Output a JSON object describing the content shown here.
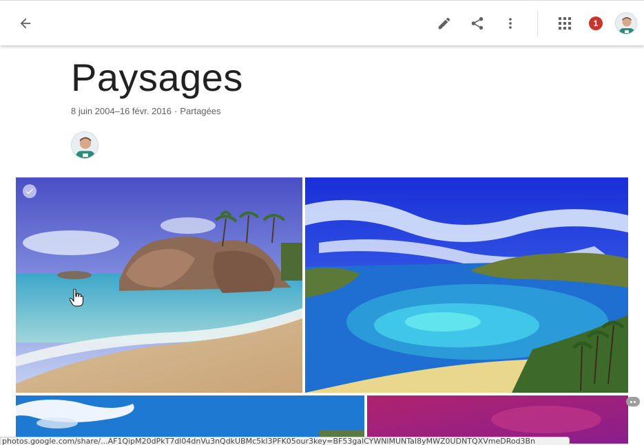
{
  "header": {
    "icons": {
      "back": "arrow-back-icon",
      "edit": "pencil-icon",
      "share": "share-icon",
      "more": "more-vert-icon",
      "apps": "apps-grid-icon"
    },
    "notification_count": "1"
  },
  "album": {
    "title": "Paysages",
    "date_range": "8 juin 2004–16 févr. 2016",
    "separator": "·",
    "sharing_status": "Partagées"
  },
  "photos": [
    {
      "scene": "beach-boulders",
      "selected_check": true
    },
    {
      "scene": "bay-lagoon"
    },
    {
      "scene": "sky-clouds"
    },
    {
      "scene": "magenta-sky"
    }
  ],
  "status_bar": {
    "url": "photos.google.com/share/...AF1QipM20dPkT7dl04dnVu3nQdkUBMc5kl3PFK05our3key=BF53galCYWNlMUNTaI8yMWZ0UDNTQXVmeDRod3Bn"
  },
  "colors": {
    "accent_badge": "#c5362c",
    "icon_gray": "#616161",
    "title_text": "#212121"
  }
}
